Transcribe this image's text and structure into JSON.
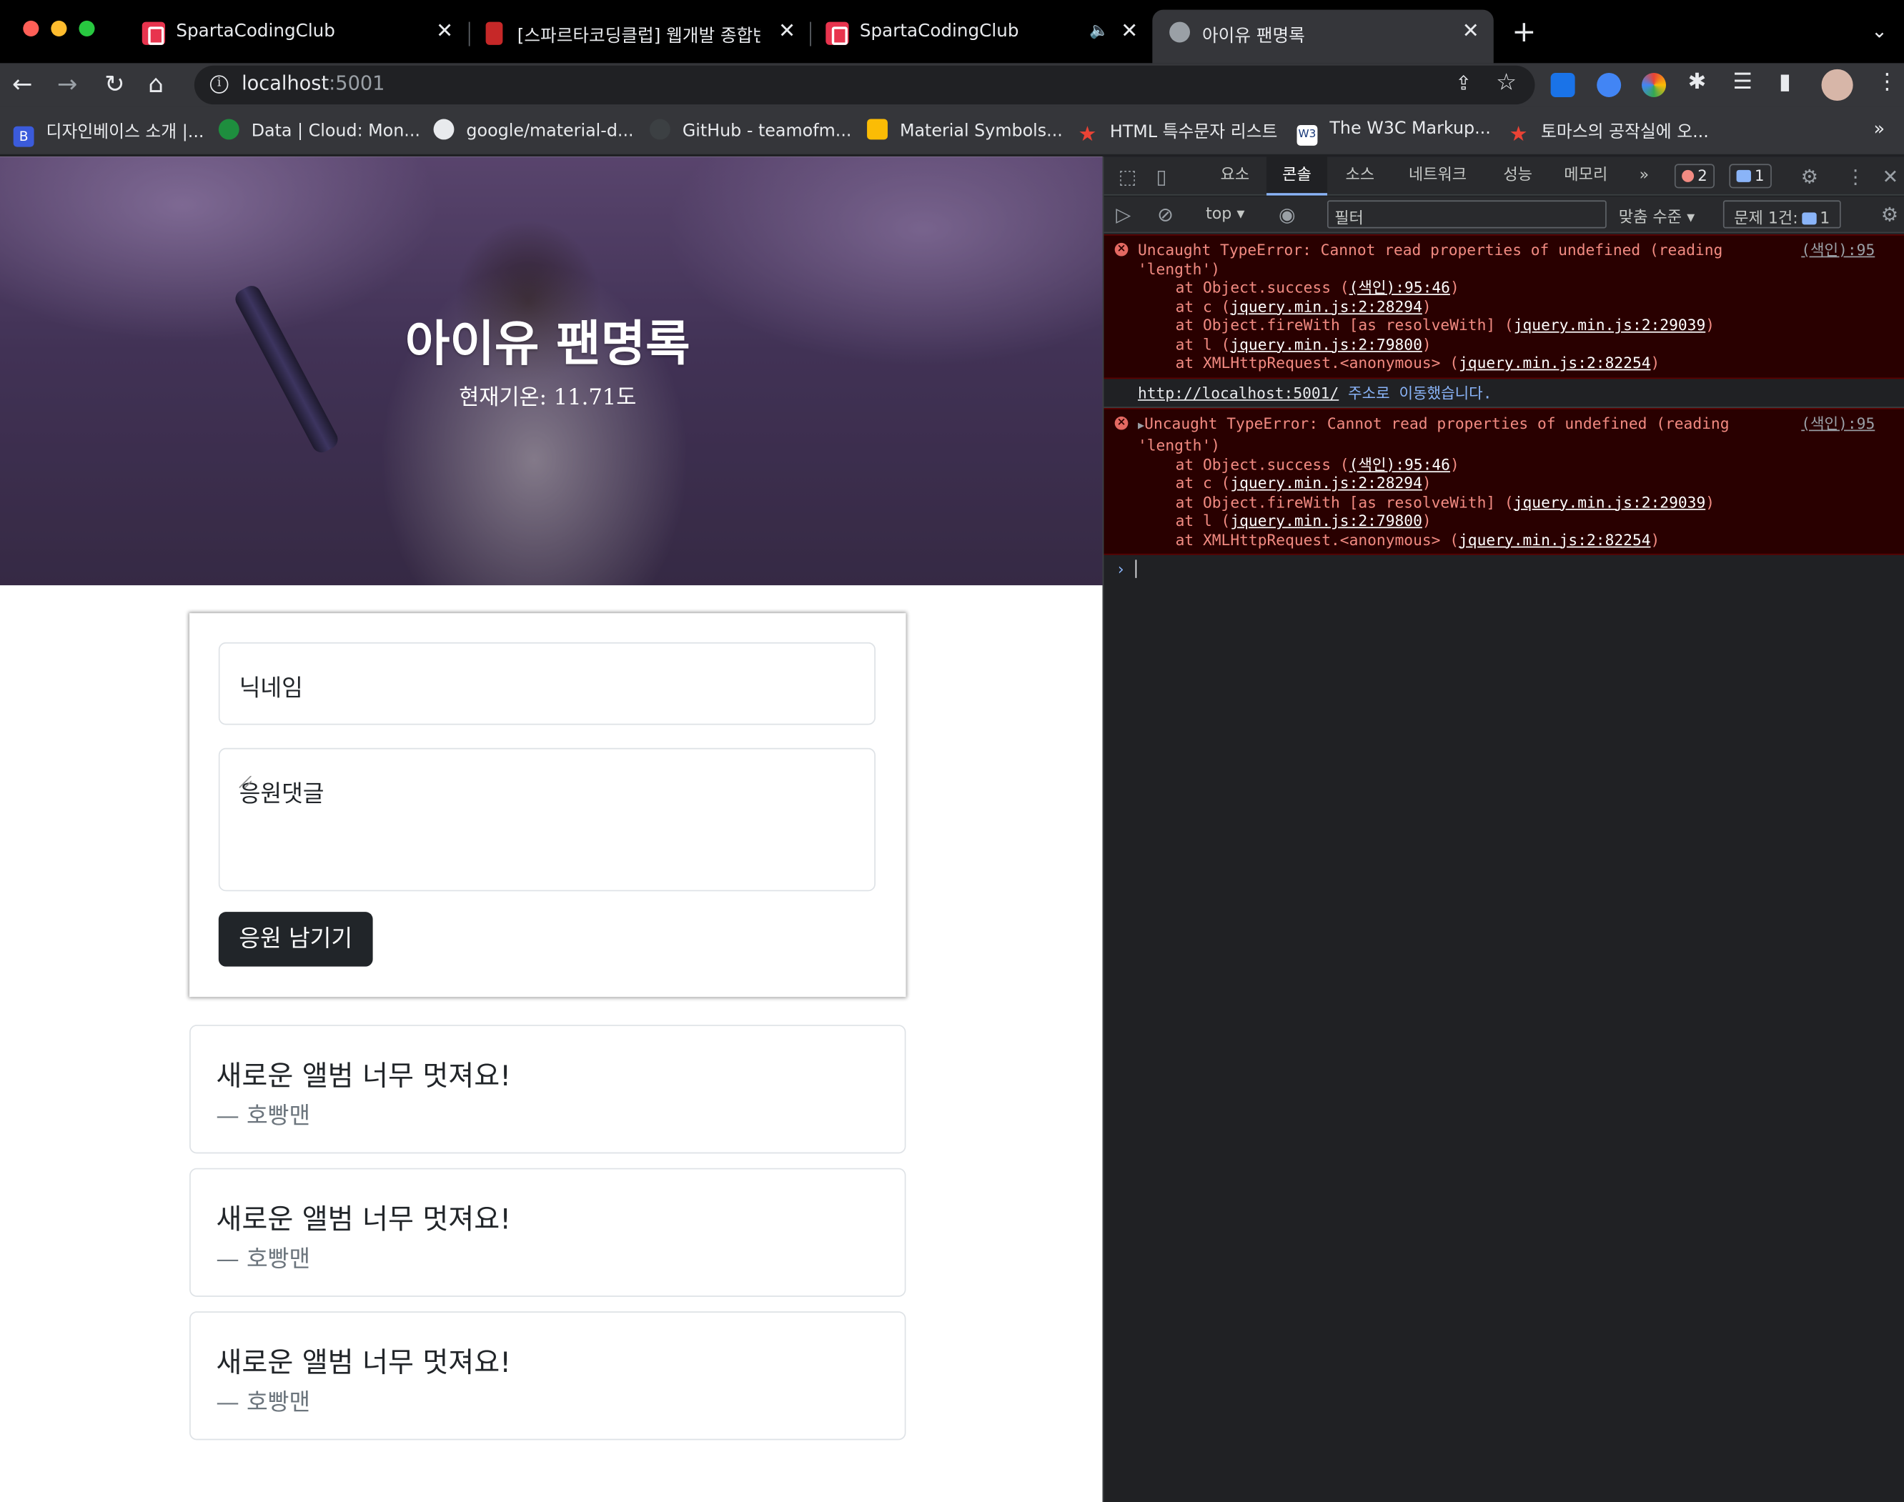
{
  "browser": {
    "tabs": [
      {
        "title": "SpartaCodingClub",
        "icon": "sparta-icon"
      },
      {
        "title": "[스파르타코딩클럽] 웹개발 종합반 -",
        "icon": "book-icon"
      },
      {
        "title": "SpartaCodingClub",
        "icon": "sparta-icon",
        "audio": true
      },
      {
        "title": "아이유 팬명록",
        "icon": "globe-icon",
        "active": true
      }
    ],
    "url_host": "localhost",
    "url_port": ":5001",
    "bookmarks": [
      "디자인베이스 소개 |...",
      "Data | Cloud: Mon...",
      "google/material-d...",
      "GitHub - teamofm...",
      "Material Symbols...",
      "HTML 특수문자 리스트",
      "The W3C Markup...",
      "토마스의 공작실에 오..."
    ],
    "more": "»"
  },
  "page": {
    "title": "아이유 팬명록",
    "weather": "현재기온: 11.71도",
    "form": {
      "name_placeholder": "닉네임",
      "comment_placeholder": "응원댓글",
      "submit_label": "응원 남기기"
    },
    "posts": [
      {
        "text": "새로운 앨범 너무 멋져요!",
        "author": "— 호빵맨"
      },
      {
        "text": "새로운 앨범 너무 멋져요!",
        "author": "— 호빵맨"
      },
      {
        "text": "새로운 앨범 너무 멋져요!",
        "author": "— 호빵맨"
      }
    ]
  },
  "devtools": {
    "tabs": [
      "요소",
      "콘솔",
      "소스",
      "네트워크",
      "성능",
      "메모리"
    ],
    "active_tab": "콘솔",
    "more_tabs": "»",
    "error_count": "2",
    "message_count": "1",
    "context": "top",
    "filter_placeholder": "필터",
    "level": "맞춤 수준",
    "issues_label": "문제 1건:",
    "issues_count": "1",
    "errors": [
      {
        "message": "Uncaught TypeError: Cannot read properties of undefined (reading",
        "message2": "'length')",
        "source": "(색인):95",
        "expanded": true,
        "stack": [
          {
            "pre": "at Object.success (",
            "link": "(색인):95:46",
            "post": ")"
          },
          {
            "pre": "at c (",
            "link": "jquery.min.js:2:28294",
            "post": ")"
          },
          {
            "pre": "at Object.fireWith [as resolveWith] (",
            "link": "jquery.min.js:2:29039",
            "post": ")"
          },
          {
            "pre": "at l (",
            "link": "jquery.min.js:2:79800",
            "post": ")"
          },
          {
            "pre": "at XMLHttpRequest.<anonymous> (",
            "link": "jquery.min.js:2:82254",
            "post": ")"
          }
        ]
      },
      {
        "message": "Uncaught TypeError: Cannot read properties of undefined (reading",
        "message2": "'length')",
        "source": "(색인):95",
        "expanded": false,
        "stack": [
          {
            "pre": "at Object.success (",
            "link": "(색인):95:46",
            "post": ")"
          },
          {
            "pre": "at c (",
            "link": "jquery.min.js:2:28294",
            "post": ")"
          },
          {
            "pre": "at Object.fireWith [as resolveWith] (",
            "link": "jquery.min.js:2:29039",
            "post": ")"
          },
          {
            "pre": "at l (",
            "link": "jquery.min.js:2:79800",
            "post": ")"
          },
          {
            "pre": "at XMLHttpRequest.<anonymous> (",
            "link": "jquery.min.js:2:82254",
            "post": ")"
          }
        ]
      }
    ],
    "navigation": {
      "url": "http://localhost:5001/",
      "text": " 주소로 이동했습니다."
    },
    "prompt": "›"
  }
}
